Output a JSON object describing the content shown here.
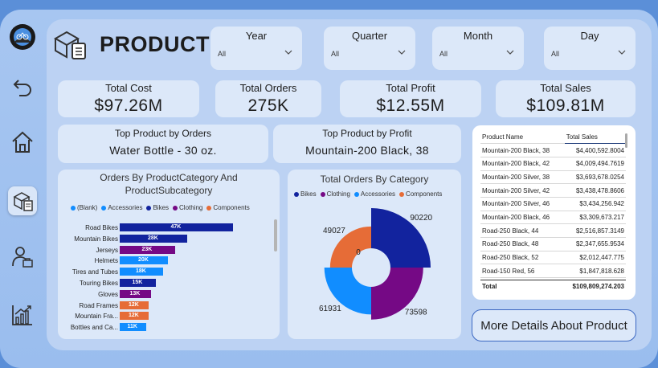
{
  "page_title": "PRODUCT",
  "slicers": [
    {
      "label": "Year",
      "value": "All"
    },
    {
      "label": "Quarter",
      "value": "All"
    },
    {
      "label": "Month",
      "value": "All"
    },
    {
      "label": "Day",
      "value": "All"
    }
  ],
  "kpis": [
    {
      "label": "Total Cost",
      "value": "$97.26M"
    },
    {
      "label": "Total Orders",
      "value": "275K"
    },
    {
      "label": "Total Profit",
      "value": "$12.55M"
    },
    {
      "label": "Total Sales",
      "value": "$109.81M"
    }
  ],
  "top_cards": [
    {
      "label": "Top Product by Orders",
      "value": "Water Bottle - 30 oz."
    },
    {
      "label": "Top Product by Profit",
      "value": "Mountain-200 Black, 38"
    }
  ],
  "bar_chart": {
    "title": "Orders By ProductCategory And ProductSubcategory",
    "legend": [
      "(Blank)",
      "Accessories",
      "Bikes",
      "Clothing",
      "Components"
    ]
  },
  "donut_chart": {
    "title": "Total Orders By Category",
    "legend": [
      "Bikes",
      "Clothing",
      "Accessories",
      "Components"
    ]
  },
  "chart_data": [
    {
      "type": "bar",
      "title": "Orders By ProductCategory And ProductSubcategory",
      "categories": [
        "Road Bikes",
        "Mountain Bikes",
        "Jerseys",
        "Helmets",
        "Tires and Tubes",
        "Touring Bikes",
        "Gloves",
        "Road Frames",
        "Mountain Fra...",
        "Bottles and Ca..."
      ],
      "values": [
        47,
        28,
        23,
        20,
        18,
        15,
        13,
        12,
        12,
        11
      ],
      "labels": [
        "47K",
        "28K",
        "23K",
        "20K",
        "18K",
        "15K",
        "13K",
        "12K",
        "12K",
        "11K"
      ],
      "category_group": [
        "Bikes",
        "Bikes",
        "Clothing",
        "Accessories",
        "Accessories",
        "Bikes",
        "Clothing",
        "Components",
        "Components",
        "Accessories"
      ],
      "legend": [
        "(Blank)",
        "Accessories",
        "Bikes",
        "Clothing",
        "Components"
      ],
      "colors": {
        "(Blank)": "#118dff",
        "Accessories": "#118dff",
        "Bikes": "#12239e",
        "Clothing": "#750985",
        "Components": "#e66c37"
      },
      "xlim": [
        0,
        50
      ]
    },
    {
      "type": "pie",
      "title": "Total Orders By Category",
      "categories": [
        "Bikes",
        "Clothing",
        "Accessories",
        "Components",
        "(Blank)"
      ],
      "values": [
        90220,
        73598,
        61931,
        49027,
        0
      ],
      "colors": [
        "#12239e",
        "#750985",
        "#118dff",
        "#e66c37",
        "#aaaaaa"
      ],
      "legend": [
        "Bikes",
        "Clothing",
        "Accessories",
        "Components"
      ]
    }
  ],
  "table": {
    "headers": [
      "Product Name",
      "Total Sales"
    ],
    "rows": [
      [
        "Mountain-200 Black, 38",
        "$4,400,592.8004"
      ],
      [
        "Mountain-200 Black, 42",
        "$4,009,494.7619"
      ],
      [
        "Mountain-200 Silver, 38",
        "$3,693,678.0254"
      ],
      [
        "Mountain-200 Silver, 42",
        "$3,438,478.8606"
      ],
      [
        "Mountain-200 Silver, 46",
        "$3,434,256.942"
      ],
      [
        "Mountain-200 Black, 46",
        "$3,309,673.217"
      ],
      [
        "Road-250 Black, 44",
        "$2,516,857.3149"
      ],
      [
        "Road-250 Black, 48",
        "$2,347,655.9534"
      ],
      [
        "Road-250 Black, 52",
        "$2,012,447.775"
      ],
      [
        "Road-150 Red, 56",
        "$1,847,818.628"
      ]
    ],
    "total_label": "Total",
    "total_value": "$109,809,274.203"
  },
  "more_button": "More Details About Product",
  "icons": [
    "logo-icon",
    "back-icon",
    "home-icon",
    "product-icon",
    "customer-icon",
    "analytics-icon",
    "product-box-icon"
  ],
  "colors": {
    "accent": "#3b67c2",
    "card": "#dce8f9",
    "background": "#bcd2f3"
  }
}
